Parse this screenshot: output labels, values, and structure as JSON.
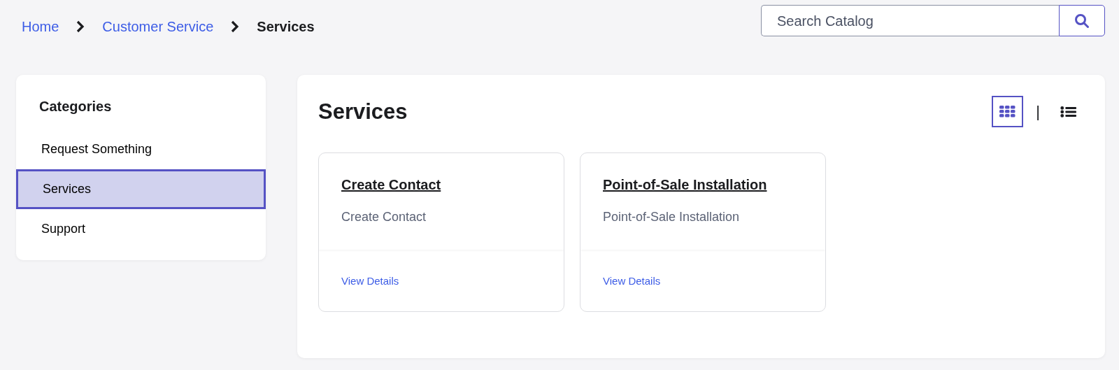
{
  "breadcrumb": [
    {
      "label": "Home",
      "current": false
    },
    {
      "label": "Customer Service",
      "current": false
    },
    {
      "label": "Services",
      "current": true
    }
  ],
  "search": {
    "placeholder": "Search Catalog"
  },
  "sidebar": {
    "title": "Categories",
    "items": [
      {
        "label": "Request Something",
        "selected": false
      },
      {
        "label": "Services",
        "selected": true
      },
      {
        "label": "Support",
        "selected": false
      }
    ]
  },
  "main": {
    "title": "Services",
    "view_toggle": {
      "separator": "|",
      "views": [
        {
          "kind": "grid",
          "selected": true
        },
        {
          "kind": "list",
          "selected": false
        }
      ]
    },
    "items": [
      {
        "title": "Create Contact",
        "description": "Create Contact",
        "link": "View Details"
      },
      {
        "title": "Point-of-Sale Installation",
        "description": "Point-of-Sale Installation",
        "link": "View Details"
      }
    ]
  }
}
